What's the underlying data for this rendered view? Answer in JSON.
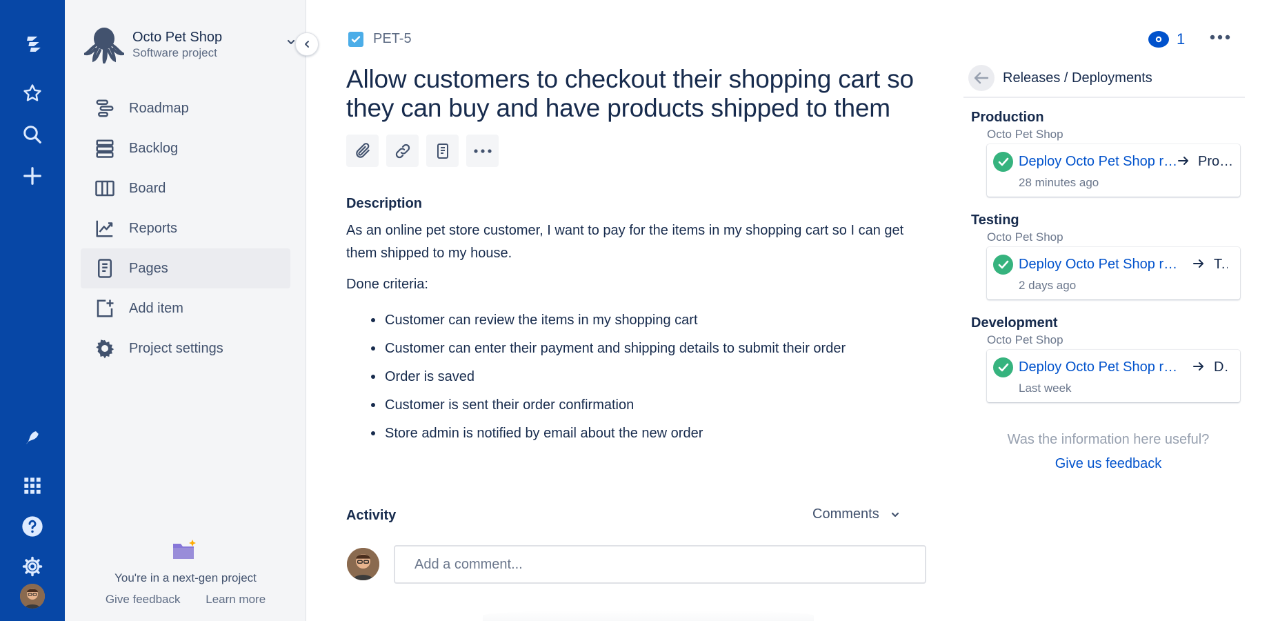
{
  "sidebar": {
    "project_name": "Octo Pet Shop",
    "project_type": "Software project",
    "items": [
      {
        "label": "Roadmap",
        "icon": "roadmap-icon"
      },
      {
        "label": "Backlog",
        "icon": "backlog-icon"
      },
      {
        "label": "Board",
        "icon": "board-icon"
      },
      {
        "label": "Reports",
        "icon": "reports-icon"
      },
      {
        "label": "Pages",
        "icon": "pages-icon",
        "active": true
      },
      {
        "label": "Add item",
        "icon": "add-item-icon"
      },
      {
        "label": "Project settings",
        "icon": "settings-icon"
      }
    ],
    "footer": {
      "message": "You're in a next-gen project",
      "give_feedback": "Give feedback",
      "learn_more": "Learn more"
    }
  },
  "issue": {
    "key": "PET-5",
    "title": "Allow customers to checkout their shopping cart so they can buy and have products shipped to them",
    "description_heading": "Description",
    "description": "As an online pet store customer, I want to pay for the items in my shopping cart so I can get them shipped to my house.",
    "done_label": "Done criteria:",
    "criteria": [
      "Customer can review the items in my shopping cart",
      "Customer can enter their payment and shipping details to submit their order",
      "Order is saved",
      "Customer is sent their order confirmation",
      "Store admin is notified by email about the new order"
    ]
  },
  "activity": {
    "heading": "Activity",
    "filter": "Comments",
    "comment_placeholder": "Add a comment..."
  },
  "header": {
    "watchers": "1"
  },
  "releases": {
    "title": "Releases / Deployments",
    "environments": [
      {
        "name": "Production",
        "project": "Octo Pet Shop",
        "deploy": "Deploy Octo Pet Shop release",
        "target": "Production",
        "when": "28 minutes ago"
      },
      {
        "name": "Testing",
        "project": "Octo Pet Shop",
        "deploy": "Deploy Octo Pet Shop release",
        "target": "Testing",
        "when": "2 days ago"
      },
      {
        "name": "Development",
        "project": "Octo Pet Shop",
        "deploy": "Deploy Octo Pet Shop release",
        "target": "Development",
        "when": "Last week"
      }
    ],
    "useful_question": "Was the information here useful?",
    "feedback_link": "Give us feedback"
  },
  "colors": {
    "rail": "#0747A6",
    "link": "#0052CC",
    "success": "#36B37E",
    "sidebar_bg": "#F4F5F7"
  }
}
